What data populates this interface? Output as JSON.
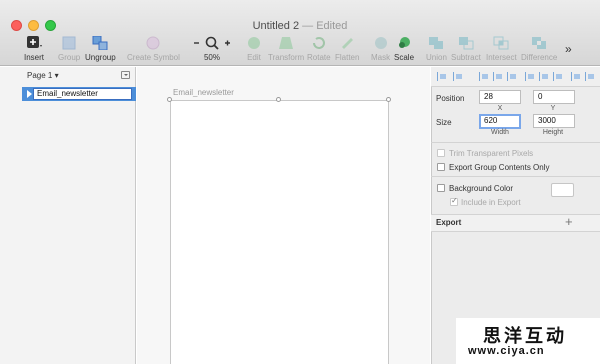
{
  "window": {
    "title": "Untitled 2",
    "edited": "— Edited"
  },
  "toolbar": {
    "insert": "Insert",
    "group": "Group",
    "ungroup": "Ungroup",
    "create_symbol": "Create Symbol",
    "zoom": "50%",
    "edit": "Edit",
    "transform": "Transform",
    "rotate": "Rotate",
    "flatten": "Flatten",
    "mask": "Mask",
    "scale": "Scale",
    "union": "Union",
    "subtract": "Subtract",
    "intersect": "Intersect",
    "difference": "Difference",
    "more": "»"
  },
  "pages": {
    "current": "Page 1 ▾"
  },
  "layers": [
    {
      "name": "Email_newsletter"
    }
  ],
  "canvas": {
    "artboard_label": "Email_newsletter"
  },
  "inspector": {
    "position_label": "Position",
    "x_value": "28",
    "y_value": "0",
    "x_sub": "X",
    "y_sub": "Y",
    "size_label": "Size",
    "width_value": "620",
    "height_value": "3000",
    "width_sub": "Width",
    "height_sub": "Height",
    "trim_label": "Trim Transparent Pixels",
    "export_group_label": "Export Group Contents Only",
    "background_label": "Background Color",
    "include_export_label": "Include in Export",
    "export_header": "Export",
    "export_add": "+"
  },
  "watermark": {
    "cn": "思洋互动",
    "url": "www.ciya.cn"
  },
  "colors": {
    "selection": "#4c8ed9",
    "focus": "#7aa7ea"
  }
}
